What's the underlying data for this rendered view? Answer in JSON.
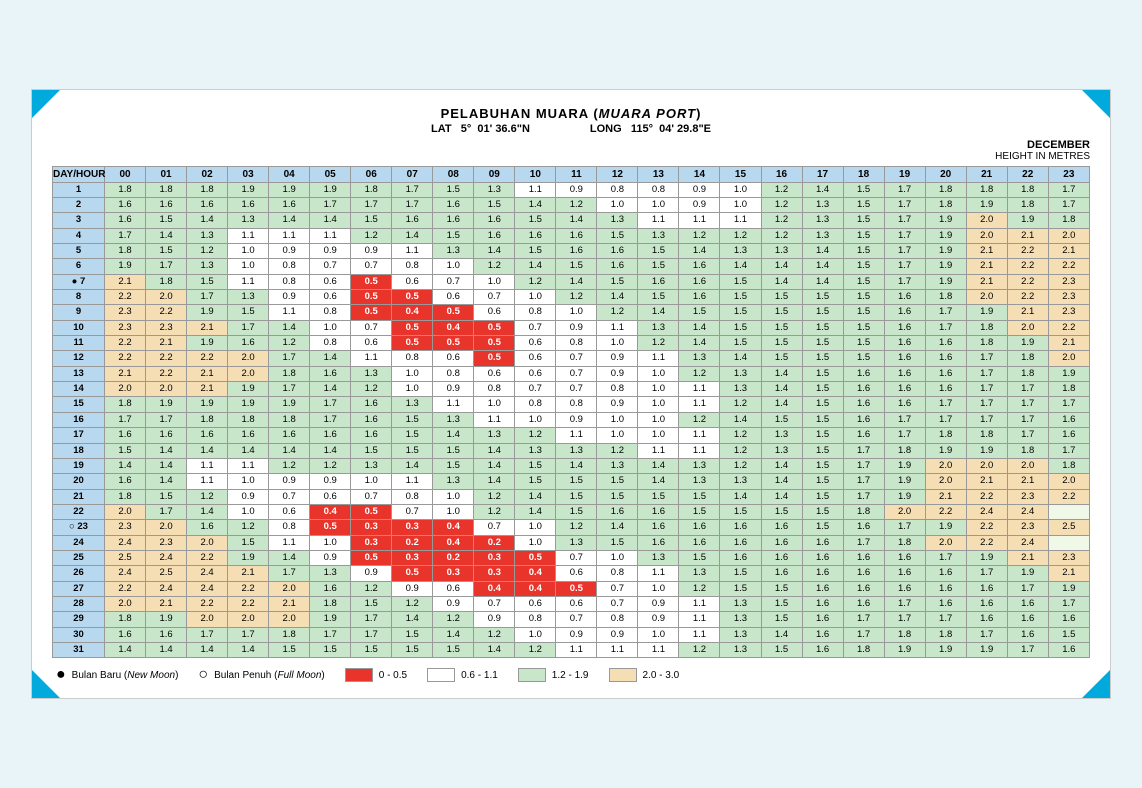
{
  "title": "PELABUHAN MUARA",
  "subtitle": "MUARA PORT",
  "lat_label": "LAT",
  "lat_deg": "5°",
  "lat_val": "01' 36.6\"N",
  "long_label": "LONG",
  "long_deg": "115°",
  "long_val": "04' 29.8\"E",
  "month": "DECEMBER",
  "height_unit": "HEIGHT IN METRES",
  "legend": {
    "new_moon_label": "Bulan Baru",
    "new_moon_sub": "New Moon",
    "full_moon_label": "Bulan Penuh",
    "full_moon_sub": "Full Moon",
    "range1": "0 - 0.5",
    "range2": "0.6 - 1.1",
    "range3": "1.2 - 1.9",
    "range4": "2.0 - 3.0"
  },
  "hours": [
    "DAY/HOUR",
    "00",
    "01",
    "02",
    "03",
    "04",
    "05",
    "06",
    "07",
    "08",
    "09",
    "10",
    "11",
    "12",
    "13",
    "14",
    "15",
    "16",
    "17",
    "18",
    "19",
    "20",
    "21",
    "22",
    "23"
  ],
  "rows": [
    {
      "day": "1",
      "marker": "",
      "vals": [
        "1.8",
        "1.8",
        "1.8",
        "1.9",
        "1.9",
        "1.9",
        "1.8",
        "1.7",
        "1.5",
        "1.3",
        "1.1",
        "0.9",
        "0.8",
        "0.8",
        "0.9",
        "1.0",
        "1.2",
        "1.4",
        "1.5",
        "1.7",
        "1.8",
        "1.8",
        "1.8",
        "1.7"
      ]
    },
    {
      "day": "2",
      "marker": "",
      "vals": [
        "1.6",
        "1.6",
        "1.6",
        "1.6",
        "1.6",
        "1.7",
        "1.7",
        "1.7",
        "1.6",
        "1.5",
        "1.4",
        "1.2",
        "1.0",
        "1.0",
        "0.9",
        "1.0",
        "1.2",
        "1.3",
        "1.5",
        "1.7",
        "1.8",
        "1.9",
        "1.8",
        "1.7"
      ]
    },
    {
      "day": "3",
      "marker": "",
      "vals": [
        "1.6",
        "1.5",
        "1.4",
        "1.3",
        "1.4",
        "1.4",
        "1.5",
        "1.6",
        "1.6",
        "1.6",
        "1.5",
        "1.4",
        "1.3",
        "1.1",
        "1.1",
        "1.1",
        "1.2",
        "1.3",
        "1.5",
        "1.7",
        "1.9",
        "2.0",
        "1.9",
        "1.8"
      ]
    },
    {
      "day": "4",
      "marker": "",
      "vals": [
        "1.7",
        "1.4",
        "1.3",
        "1.1",
        "1.1",
        "1.1",
        "1.2",
        "1.4",
        "1.5",
        "1.6",
        "1.6",
        "1.6",
        "1.5",
        "1.3",
        "1.2",
        "1.2",
        "1.2",
        "1.3",
        "1.5",
        "1.7",
        "1.9",
        "2.0",
        "2.1",
        "2.0"
      ]
    },
    {
      "day": "5",
      "marker": "",
      "vals": [
        "1.8",
        "1.5",
        "1.2",
        "1.0",
        "0.9",
        "0.9",
        "0.9",
        "1.1",
        "1.3",
        "1.4",
        "1.5",
        "1.6",
        "1.6",
        "1.5",
        "1.4",
        "1.3",
        "1.3",
        "1.4",
        "1.5",
        "1.7",
        "1.9",
        "2.1",
        "2.2",
        "2.1"
      ]
    },
    {
      "day": "6",
      "marker": "",
      "vals": [
        "1.9",
        "1.7",
        "1.3",
        "1.0",
        "0.8",
        "0.7",
        "0.7",
        "0.8",
        "1.0",
        "1.2",
        "1.4",
        "1.5",
        "1.6",
        "1.5",
        "1.6",
        "1.4",
        "1.4",
        "1.4",
        "1.5",
        "1.7",
        "1.9",
        "2.1",
        "2.2",
        "2.2"
      ]
    },
    {
      "day": "7",
      "marker": "●",
      "vals": [
        "2.1",
        "1.8",
        "1.5",
        "1.1",
        "0.8",
        "0.6",
        "0.5",
        "0.6",
        "0.7",
        "1.0",
        "1.2",
        "1.4",
        "1.5",
        "1.6",
        "1.6",
        "1.5",
        "1.4",
        "1.4",
        "1.5",
        "1.7",
        "1.9",
        "2.1",
        "2.2",
        "2.3"
      ]
    },
    {
      "day": "8",
      "marker": "",
      "vals": [
        "2.2",
        "2.0",
        "1.7",
        "1.3",
        "0.9",
        "0.6",
        "0.5",
        "0.5",
        "0.6",
        "0.7",
        "1.0",
        "1.2",
        "1.4",
        "1.5",
        "1.6",
        "1.5",
        "1.5",
        "1.5",
        "1.5",
        "1.6",
        "1.8",
        "2.0",
        "2.2",
        "2.3"
      ]
    },
    {
      "day": "9",
      "marker": "",
      "vals": [
        "2.3",
        "2.2",
        "1.9",
        "1.5",
        "1.1",
        "0.8",
        "0.5",
        "0.4",
        "0.5",
        "0.6",
        "0.8",
        "1.0",
        "1.2",
        "1.4",
        "1.5",
        "1.5",
        "1.5",
        "1.5",
        "1.5",
        "1.6",
        "1.7",
        "1.9",
        "2.1",
        "2.3"
      ]
    },
    {
      "day": "10",
      "marker": "",
      "vals": [
        "2.3",
        "2.3",
        "2.1",
        "1.7",
        "1.4",
        "1.0",
        "0.7",
        "0.5",
        "0.4",
        "0.5",
        "0.7",
        "0.9",
        "1.1",
        "1.3",
        "1.4",
        "1.5",
        "1.5",
        "1.5",
        "1.5",
        "1.6",
        "1.7",
        "1.8",
        "2.0",
        "2.2"
      ]
    },
    {
      "day": "11",
      "marker": "",
      "vals": [
        "2.2",
        "2.1",
        "1.9",
        "1.6",
        "1.2",
        "0.8",
        "0.6",
        "0.5",
        "0.5",
        "0.5",
        "0.6",
        "0.8",
        "1.0",
        "1.2",
        "1.4",
        "1.5",
        "1.5",
        "1.5",
        "1.5",
        "1.6",
        "1.6",
        "1.8",
        "1.9",
        "2.1"
      ]
    },
    {
      "day": "12",
      "marker": "",
      "vals": [
        "2.2",
        "2.2",
        "2.2",
        "2.0",
        "1.7",
        "1.4",
        "1.1",
        "0.8",
        "0.6",
        "0.5",
        "0.6",
        "0.7",
        "0.9",
        "1.1",
        "1.3",
        "1.4",
        "1.5",
        "1.5",
        "1.5",
        "1.6",
        "1.6",
        "1.7",
        "1.8",
        "2.0"
      ]
    },
    {
      "day": "13",
      "marker": "",
      "vals": [
        "2.1",
        "2.2",
        "2.1",
        "2.0",
        "1.8",
        "1.6",
        "1.3",
        "1.0",
        "0.8",
        "0.6",
        "0.6",
        "0.7",
        "0.9",
        "1.0",
        "1.2",
        "1.3",
        "1.4",
        "1.5",
        "1.6",
        "1.6",
        "1.6",
        "1.7",
        "1.8",
        "1.9"
      ]
    },
    {
      "day": "14",
      "marker": "",
      "vals": [
        "2.0",
        "2.0",
        "2.1",
        "1.9",
        "1.7",
        "1.4",
        "1.2",
        "1.0",
        "0.9",
        "0.8",
        "0.7",
        "0.7",
        "0.8",
        "1.0",
        "1.1",
        "1.3",
        "1.4",
        "1.5",
        "1.6",
        "1.6",
        "1.6",
        "1.7",
        "1.7",
        "1.8"
      ]
    },
    {
      "day": "15",
      "marker": "",
      "vals": [
        "1.8",
        "1.9",
        "1.9",
        "1.9",
        "1.9",
        "1.7",
        "1.6",
        "1.3",
        "1.1",
        "1.0",
        "0.8",
        "0.8",
        "0.9",
        "1.0",
        "1.1",
        "1.2",
        "1.4",
        "1.5",
        "1.6",
        "1.6",
        "1.7",
        "1.7",
        "1.7",
        "1.7"
      ]
    },
    {
      "day": "16",
      "marker": "",
      "vals": [
        "1.7",
        "1.7",
        "1.8",
        "1.8",
        "1.8",
        "1.7",
        "1.6",
        "1.5",
        "1.3",
        "1.1",
        "1.0",
        "0.9",
        "1.0",
        "1.0",
        "1.2",
        "1.4",
        "1.5",
        "1.5",
        "1.6",
        "1.7",
        "1.7",
        "1.7",
        "1.7",
        "1.6"
      ]
    },
    {
      "day": "17",
      "marker": "",
      "vals": [
        "1.6",
        "1.6",
        "1.6",
        "1.6",
        "1.6",
        "1.6",
        "1.6",
        "1.5",
        "1.4",
        "1.3",
        "1.2",
        "1.1",
        "1.0",
        "1.0",
        "1.1",
        "1.2",
        "1.3",
        "1.5",
        "1.6",
        "1.7",
        "1.8",
        "1.8",
        "1.7",
        "1.6"
      ]
    },
    {
      "day": "18",
      "marker": "",
      "vals": [
        "1.5",
        "1.4",
        "1.4",
        "1.4",
        "1.4",
        "1.4",
        "1.5",
        "1.5",
        "1.5",
        "1.4",
        "1.3",
        "1.3",
        "1.2",
        "1.1",
        "1.1",
        "1.2",
        "1.3",
        "1.5",
        "1.7",
        "1.8",
        "1.9",
        "1.9",
        "1.8",
        "1.7"
      ]
    },
    {
      "day": "19",
      "marker": "",
      "vals": [
        "1.4",
        "1.4",
        "1.1",
        "1.1",
        "1.2",
        "1.2",
        "1.3",
        "1.4",
        "1.5",
        "1.4",
        "1.5",
        "1.4",
        "1.3",
        "1.4",
        "1.3",
        "1.2",
        "1.4",
        "1.5",
        "1.7",
        "1.9",
        "2.0",
        "2.0",
        "2.0",
        "1.8"
      ]
    },
    {
      "day": "20",
      "marker": "",
      "vals": [
        "1.6",
        "1.4",
        "1.1",
        "1.0",
        "0.9",
        "0.9",
        "1.0",
        "1.1",
        "1.3",
        "1.4",
        "1.5",
        "1.5",
        "1.5",
        "1.4",
        "1.3",
        "1.3",
        "1.4",
        "1.5",
        "1.7",
        "1.9",
        "2.0",
        "2.1",
        "2.1",
        "2.0"
      ]
    },
    {
      "day": "21",
      "marker": "",
      "vals": [
        "1.8",
        "1.5",
        "1.2",
        "0.9",
        "0.7",
        "0.6",
        "0.7",
        "0.8",
        "1.0",
        "1.2",
        "1.4",
        "1.5",
        "1.5",
        "1.5",
        "1.5",
        "1.4",
        "1.4",
        "1.5",
        "1.7",
        "1.9",
        "2.1",
        "2.2",
        "2.3",
        "2.2"
      ]
    },
    {
      "day": "22",
      "marker": "",
      "vals": [
        "2.0",
        "1.7",
        "1.4",
        "1.0",
        "0.6",
        "0.4",
        "0.5",
        "0.7",
        "1.0",
        "1.2",
        "1.4",
        "1.5",
        "1.6",
        "1.6",
        "1.5",
        "1.5",
        "1.5",
        "1.5",
        "1.8",
        "2.0",
        "2.2",
        "2.4",
        "2.4"
      ]
    },
    {
      "day": "23",
      "marker": "○",
      "vals": [
        "2.3",
        "2.0",
        "1.6",
        "1.2",
        "0.8",
        "0.5",
        "0.3",
        "0.3",
        "0.4",
        "0.7",
        "1.0",
        "1.2",
        "1.4",
        "1.6",
        "1.6",
        "1.6",
        "1.6",
        "1.5",
        "1.6",
        "1.7",
        "1.9",
        "2.2",
        "2.3",
        "2.5"
      ]
    },
    {
      "day": "24",
      "marker": "",
      "vals": [
        "2.4",
        "2.3",
        "2.0",
        "1.5",
        "1.1",
        "1.0",
        "0.3",
        "0.2",
        "0.4",
        "0.2",
        "1.0",
        "1.3",
        "1.5",
        "1.6",
        "1.6",
        "1.6",
        "1.6",
        "1.6",
        "1.7",
        "1.8",
        "2.0",
        "2.2",
        "2.4"
      ]
    },
    {
      "day": "25",
      "marker": "",
      "vals": [
        "2.5",
        "2.4",
        "2.2",
        "1.9",
        "1.4",
        "0.9",
        "0.5",
        "0.3",
        "0.2",
        "0.3",
        "0.5",
        "0.7",
        "1.0",
        "1.3",
        "1.5",
        "1.6",
        "1.6",
        "1.6",
        "1.6",
        "1.6",
        "1.7",
        "1.9",
        "2.1",
        "2.3"
      ]
    },
    {
      "day": "26",
      "marker": "",
      "vals": [
        "2.4",
        "2.5",
        "2.4",
        "2.1",
        "1.7",
        "1.3",
        "0.9",
        "0.5",
        "0.3",
        "0.3",
        "0.4",
        "0.6",
        "0.8",
        "1.1",
        "1.3",
        "1.5",
        "1.6",
        "1.6",
        "1.6",
        "1.6",
        "1.6",
        "1.7",
        "1.9",
        "2.1"
      ]
    },
    {
      "day": "27",
      "marker": "",
      "vals": [
        "2.2",
        "2.4",
        "2.4",
        "2.2",
        "2.0",
        "1.6",
        "1.2",
        "0.9",
        "0.6",
        "0.4",
        "0.4",
        "0.5",
        "0.7",
        "1.0",
        "1.2",
        "1.5",
        "1.5",
        "1.6",
        "1.6",
        "1.6",
        "1.6",
        "1.6",
        "1.7",
        "1.9"
      ]
    },
    {
      "day": "28",
      "marker": "",
      "vals": [
        "2.0",
        "2.1",
        "2.2",
        "2.2",
        "2.1",
        "1.8",
        "1.5",
        "1.2",
        "0.9",
        "0.7",
        "0.6",
        "0.6",
        "0.7",
        "0.9",
        "1.1",
        "1.3",
        "1.5",
        "1.6",
        "1.6",
        "1.7",
        "1.6",
        "1.6",
        "1.6",
        "1.7"
      ]
    },
    {
      "day": "29",
      "marker": "",
      "vals": [
        "1.8",
        "1.9",
        "2.0",
        "2.0",
        "2.0",
        "1.9",
        "1.7",
        "1.4",
        "1.2",
        "0.9",
        "0.8",
        "0.7",
        "0.8",
        "0.9",
        "1.1",
        "1.3",
        "1.5",
        "1.6",
        "1.7",
        "1.7",
        "1.7",
        "1.6",
        "1.6",
        "1.6"
      ]
    },
    {
      "day": "30",
      "marker": "",
      "vals": [
        "1.6",
        "1.6",
        "1.7",
        "1.7",
        "1.8",
        "1.7",
        "1.7",
        "1.5",
        "1.4",
        "1.2",
        "1.0",
        "0.9",
        "0.9",
        "1.0",
        "1.1",
        "1.3",
        "1.4",
        "1.6",
        "1.7",
        "1.8",
        "1.8",
        "1.7",
        "1.6",
        "1.5"
      ]
    },
    {
      "day": "31",
      "marker": "",
      "vals": [
        "1.4",
        "1.4",
        "1.4",
        "1.4",
        "1.5",
        "1.5",
        "1.5",
        "1.5",
        "1.5",
        "1.4",
        "1.2",
        "1.1",
        "1.1",
        "1.1",
        "1.2",
        "1.3",
        "1.5",
        "1.6",
        "1.8",
        "1.9",
        "1.9",
        "1.9",
        "1.7",
        "1.6"
      ]
    }
  ]
}
